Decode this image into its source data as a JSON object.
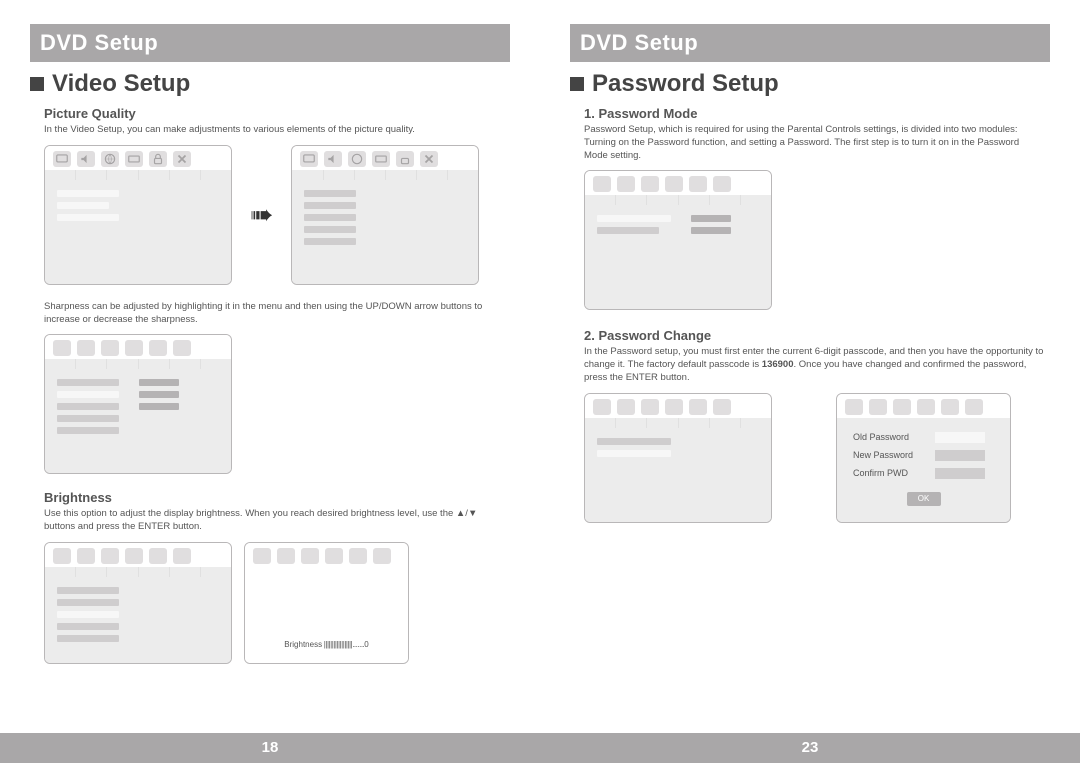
{
  "left": {
    "banner": "DVD Setup",
    "section": "Video Setup",
    "picture_quality": {
      "heading": "Picture Quality",
      "text1": "In the Video Setup, you can make adjustments to various elements of the picture quality.",
      "text2": "Sharpness can be adjusted by highlighting it in the menu and then using the UP/DOWN arrow buttons to increase or decrease the sharpness."
    },
    "brightness": {
      "heading": "Brightness",
      "text": "Use this option to adjust the display brightness. When you reach desired brightness level, use the ▲/▼ buttons and press the ENTER button.",
      "label": "Brightness",
      "value": "0"
    },
    "page_number": "18"
  },
  "right": {
    "banner": "DVD Setup",
    "section": "Password Setup",
    "password_mode": {
      "heading": "1. Password Mode",
      "text": "Password Setup, which is required for using the Parental Controls settings, is divided into two modules: Turning on the Password function, and setting a Password. The first step is to turn it on in the Password Mode setting."
    },
    "password_change": {
      "heading": "2. Password Change",
      "text_pre": "In the Password setup, you must first enter the current 6-digit passcode, and then you have the opportunity to change it. The factory default passcode is ",
      "default_passcode": "136900",
      "text_post": ". Once you have changed and confirmed the password, press the ENTER button.",
      "dialog": {
        "old": "Old Password",
        "new": "New Password",
        "confirm": "Confirm PWD",
        "ok": "OK"
      }
    },
    "page_number": "23"
  }
}
